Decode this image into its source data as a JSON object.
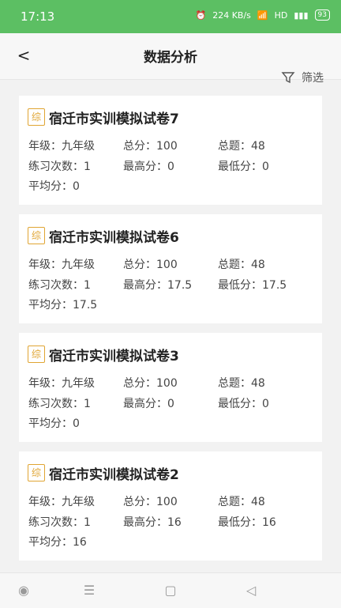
{
  "status_bar": {
    "time": "17:13",
    "network": "224 KB/s",
    "hd": "HD",
    "battery": "93"
  },
  "header": {
    "title": "数据分析"
  },
  "filter": {
    "label": "筛选"
  },
  "cards": [
    {
      "badge": "综",
      "title": "宿迁市实训模拟试卷7",
      "grade": "年级：九年级",
      "total_score": "总分：100",
      "total_questions": "总题：48",
      "practice_count": "练习次数：1",
      "max_score": "最高分：0",
      "min_score": "最低分：0",
      "avg_score": "平均分：0"
    },
    {
      "badge": "综",
      "title": "宿迁市实训模拟试卷6",
      "grade": "年级：九年级",
      "total_score": "总分：100",
      "total_questions": "总题：48",
      "practice_count": "练习次数：1",
      "max_score": "最高分：17.5",
      "min_score": "最低分：17.5",
      "avg_score": "平均分：17.5"
    },
    {
      "badge": "综",
      "title": "宿迁市实训模拟试卷3",
      "grade": "年级：九年级",
      "total_score": "总分：100",
      "total_questions": "总题：48",
      "practice_count": "练习次数：1",
      "max_score": "最高分：0",
      "min_score": "最低分：0",
      "avg_score": "平均分：0"
    },
    {
      "badge": "综",
      "title": "宿迁市实训模拟试卷2",
      "grade": "年级：九年级",
      "total_score": "总分：100",
      "total_questions": "总题：48",
      "practice_count": "练习次数：1",
      "max_score": "最高分：16",
      "min_score": "最低分：16",
      "avg_score": "平均分：16"
    }
  ],
  "colors": {
    "status_bar": "#5cbf63",
    "badge": "#e0a533",
    "background": "#f2f2f2"
  }
}
